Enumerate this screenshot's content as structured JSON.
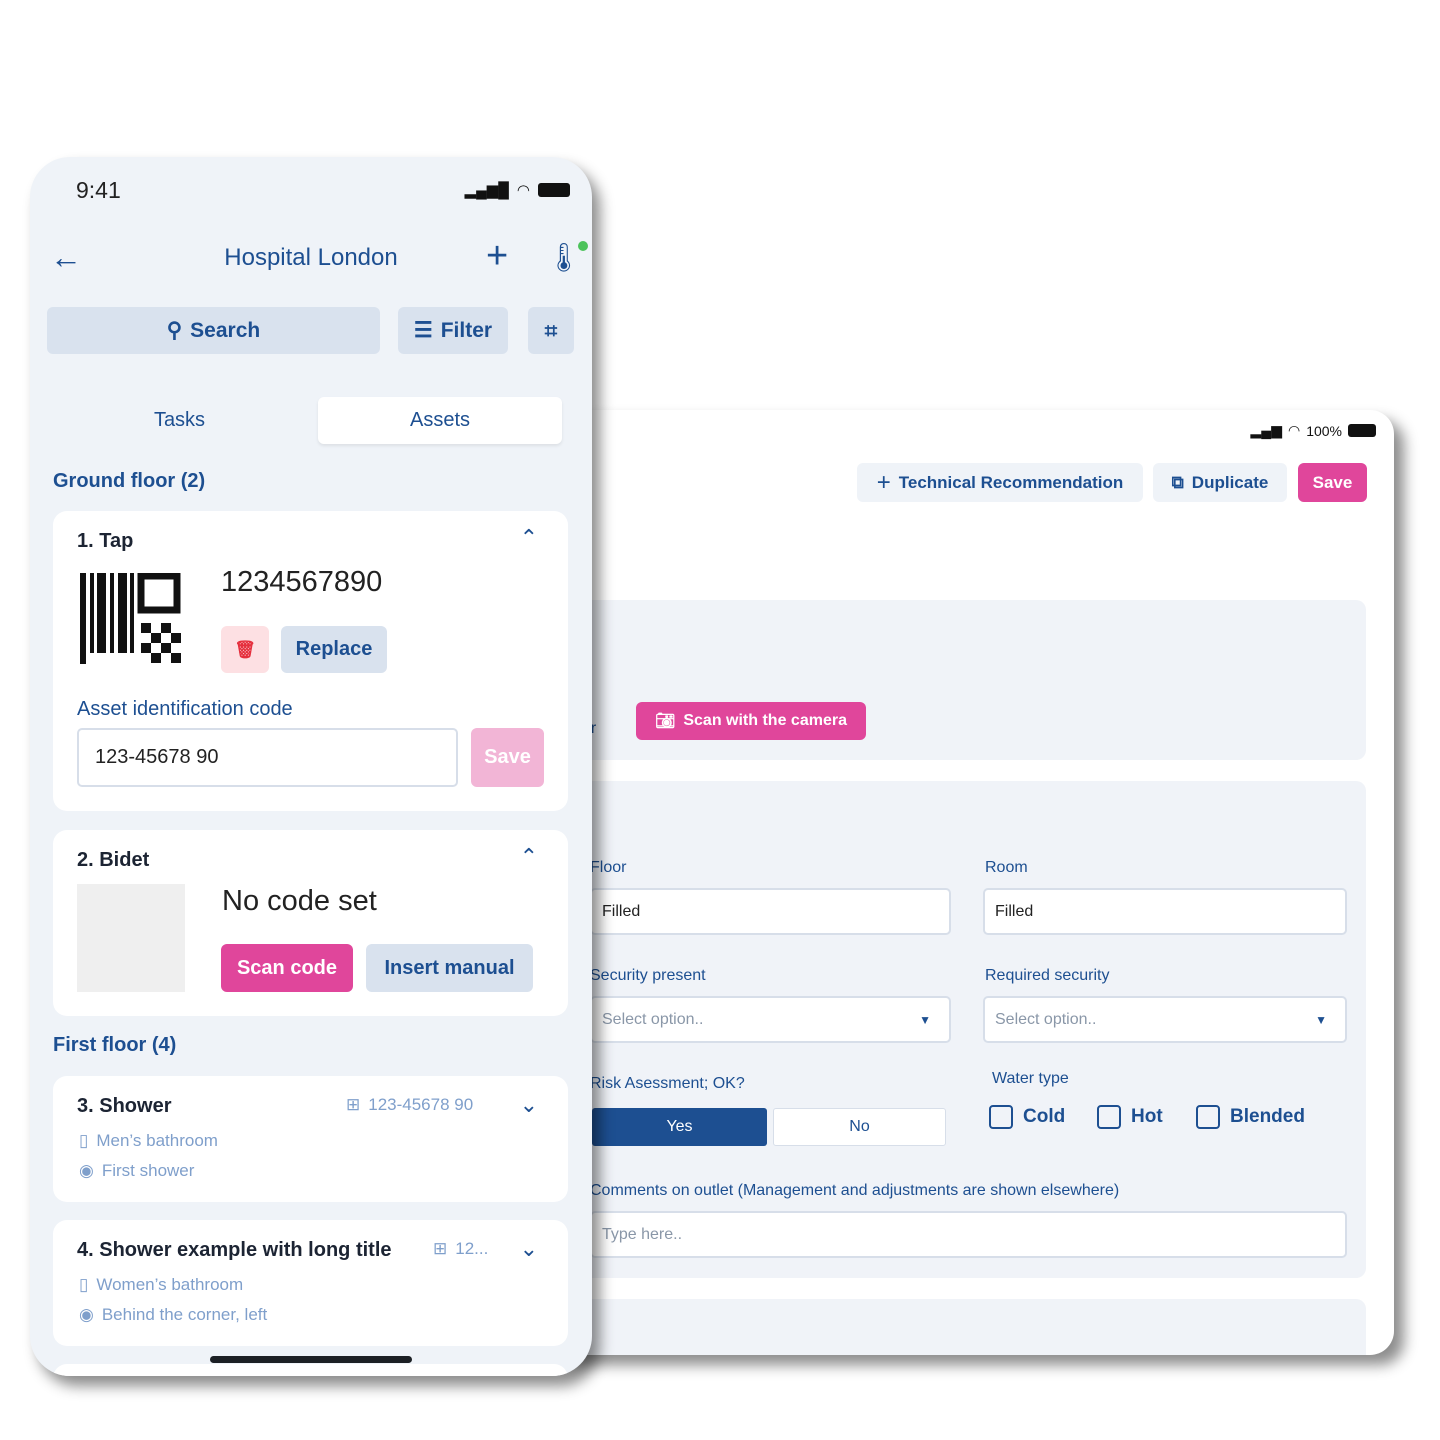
{
  "tablet": {
    "status": {
      "battery": "100%"
    },
    "actions": {
      "tech_rec": "Technical Recommendation",
      "duplicate": "Duplicate",
      "save": "Save"
    },
    "scan": {
      "or_text": "or",
      "scan_camera": "Scan with the camera"
    },
    "form": {
      "floor_label": "Floor",
      "floor_value": "Filled",
      "room_label": "Room",
      "room_value": "Filled",
      "security_present_label": "Security present",
      "security_present_placeholder": "Select option..",
      "required_security_label": "Required security",
      "required_security_placeholder": "Select option..",
      "risk_label": "Risk Asessment; OK?",
      "yes": "Yes",
      "no": "No",
      "water_label": "Water type",
      "water_options": [
        "Cold",
        "Hot",
        "Blended"
      ],
      "comments_label": "Comments on outlet (Management and adjustments are shown elsewhere)",
      "comments_placeholder": "Type here.."
    }
  },
  "phone": {
    "time": "9:41",
    "title": "Hospital London",
    "search": "Search",
    "filter": "Filter",
    "tabs": [
      "Tasks",
      "Assets"
    ],
    "groups": [
      {
        "title": "Ground floor (2)"
      },
      {
        "title": "First floor (4)"
      }
    ],
    "items": [
      {
        "title": "1. Tap",
        "code": "1234567890",
        "replace": "Replace",
        "field_label": "Asset identification code",
        "field_value": "123-45678 90",
        "save": "Save"
      },
      {
        "title": "2. Bidet",
        "code": "No code set",
        "scan": "Scan code",
        "manual": "Insert manual"
      },
      {
        "title": "3. Shower",
        "code": "123-45678 90",
        "room": "Men’s bathroom",
        "location": "First shower"
      },
      {
        "title": "4. Shower example with long title",
        "code": "12...",
        "room": "Women’s bathroom",
        "location": "Behind the corner, left"
      }
    ]
  },
  "colors": {
    "primary": "#1d4f91",
    "accent": "#e0469b",
    "background": "#eff3f8"
  }
}
